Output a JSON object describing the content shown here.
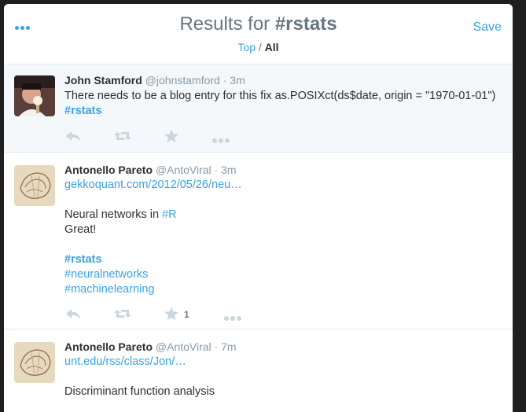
{
  "header": {
    "title_prefix": "Results for ",
    "title_query": "#rstats",
    "tab_top": "Top",
    "separator": " / ",
    "tab_all": "All",
    "save_label": "Save"
  },
  "tweets": [
    {
      "name": "John Stamford",
      "handle": "@johnstamford",
      "sep": " · ",
      "time": "3m",
      "text": "There needs to be a blog entry for this fix as.POSIXct(ds$date, origin = \"1970-01-01\") ",
      "hashtag": "#rstats"
    },
    {
      "name": "Antonello Pareto",
      "handle": "@AntoViral",
      "sep": " · ",
      "time": "3m",
      "link": "gekkoquant.com/2012/05/26/neu…",
      "line1": "Neural networks in ",
      "line1_tag": "#R",
      "line2": "Great!",
      "tag1": "#rstats",
      "tag2": "#neuralnetworks",
      "tag3": "#machinelearning",
      "favorite_count": "1"
    },
    {
      "name": "Antonello Pareto",
      "handle": "@AntoViral",
      "sep": " · ",
      "time": "7m",
      "link": "unt.edu/rss/class/Jon/…",
      "line1": "Discriminant function analysis"
    }
  ],
  "icons": {
    "more": "more-dots-icon",
    "reply": "reply-icon",
    "retweet": "retweet-icon",
    "favorite": "star-icon",
    "overflow": "more-horizontal-icon"
  },
  "colors": {
    "accent": "#3aa3e3",
    "muted": "#8899a6",
    "highlight_bg": "#f5f8fa"
  }
}
